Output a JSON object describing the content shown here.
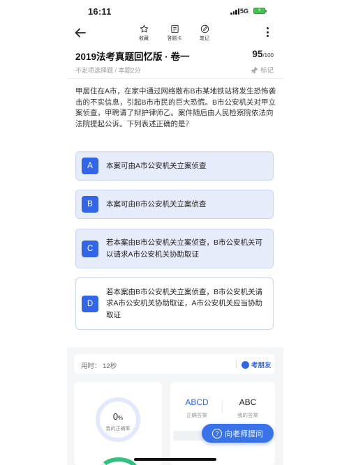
{
  "status_bar": {
    "time": "16:11",
    "network": "5G"
  },
  "toolbar": {
    "favorite_label": "收藏",
    "answer_sheet_label": "答题卡",
    "notes_label": "笔记"
  },
  "header": {
    "title": "2019法考真题回忆版 · 卷一",
    "score": "95",
    "score_max": "/100",
    "meta": "不定项选择题 / 本题2分",
    "mark_label": "标记"
  },
  "question": {
    "stem": "甲居住在A市，在家中通过网络散布B市某地铁站将发生恐怖袭击的不实信息，引起B市市民的巨大恐慌。B市公安机关对甲立案侦查，甲聘请了辩护律师乙。案件随后由人民检察院依法向法院提起公诉。下列表述正确的是？",
    "options": [
      {
        "letter": "A",
        "text": "本案可由A市公安机关立案侦查"
      },
      {
        "letter": "B",
        "text": "本案可由B市公安机关立案侦查"
      },
      {
        "letter": "C",
        "text": "若本案由B市公安机关立案侦查，B市公安机关可以请求A市公安机关协助取证"
      },
      {
        "letter": "D",
        "text": "若本案由B市公安机关立案侦查，B市公安机关请求A市公安机关协助取证，A市公安机关应当协助取证"
      }
    ]
  },
  "stats": {
    "time_used": "用时：  12秒",
    "friend_label": "考朋友",
    "accuracy_value": "0",
    "accuracy_unit": "%",
    "accuracy_caption": "我的正确率",
    "correct_answer": "ABCD",
    "correct_answer_label": "正确答案",
    "my_answer": "ABC",
    "my_answer_label": "我的答案"
  },
  "ask_teacher_label": "向老师提问"
}
